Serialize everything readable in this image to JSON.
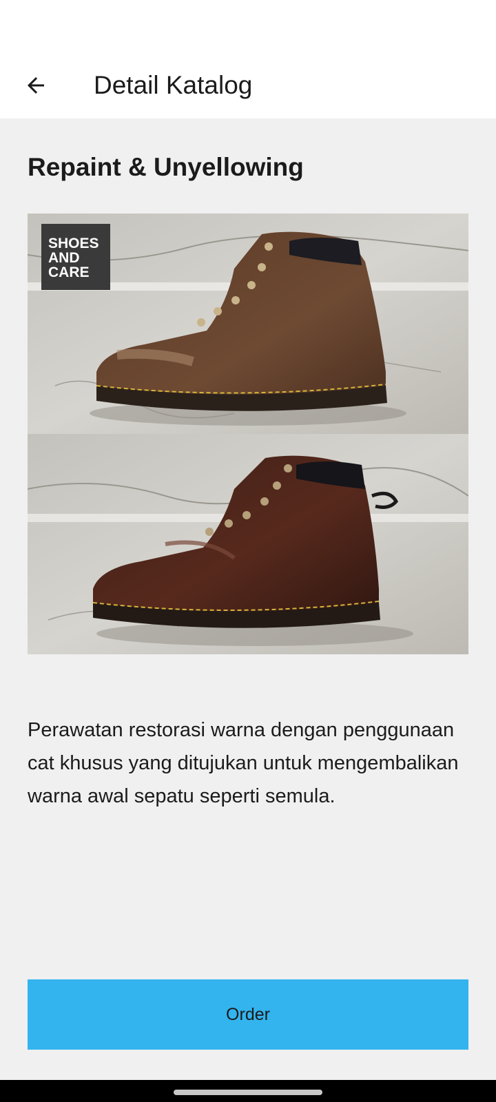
{
  "app_bar": {
    "back_icon": "arrow-left-icon",
    "title": "Detail Katalog"
  },
  "catalog": {
    "title": "Repaint & Unyellowing",
    "image": {
      "content": "before-after photo of a brown leather boot restoration",
      "logo_text": [
        "SHOES",
        "AND",
        "CARE"
      ]
    },
    "description": "Perawatan restorasi warna dengan penggunaan cat khusus yang ditujukan untuk mengembalikan warna awal sepatu seperti semula."
  },
  "order_button": {
    "label": "Order"
  },
  "colors": {
    "accent": "#33b4ee",
    "background": "#f0f0f0",
    "app_bar": "#ffffff",
    "text": "#1b1b1b"
  }
}
